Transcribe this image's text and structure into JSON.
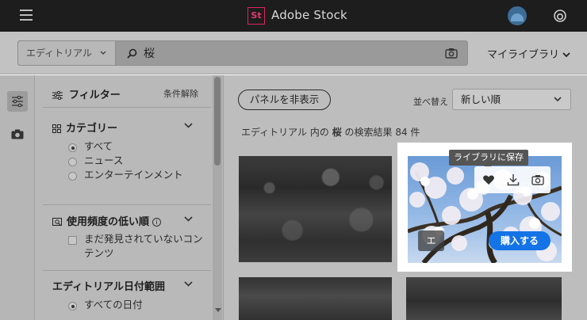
{
  "header": {
    "logo_text": "St",
    "brand": "Adobe Stock",
    "icons": [
      "hamburger-icon",
      "avatar",
      "creative-cloud-icon"
    ]
  },
  "search": {
    "type_selector": "エディトリアル",
    "query": "桜",
    "my_libraries": "マイライブラリ"
  },
  "filters": {
    "title": "フィルター",
    "clear_label": "条件解除",
    "categories": {
      "title": "カテゴリー",
      "options": [
        {
          "label": "すべて",
          "selected": true
        },
        {
          "label": "ニュース",
          "selected": false
        },
        {
          "label": "エンターテインメント",
          "selected": false
        }
      ]
    },
    "usage": {
      "title": "使用頻度の低い順",
      "info": "i",
      "option": "まだ発見されていないコンテンツ"
    },
    "date_range": {
      "title": "エディトリアル日付範囲",
      "option": "すべての日付"
    }
  },
  "results": {
    "hide_panel": "パネルを非表示",
    "sort_label": "並べ替え",
    "sort_value": "新しい順",
    "summary_prefix": "エディトリアル 内の",
    "summary_query": "桜",
    "summary_suffix": "の検索結果 84 件"
  },
  "card": {
    "tooltip": "ライブラリに保存",
    "tag": "エ",
    "buy_label": "購入する"
  },
  "colors": {
    "accent": "#1473e6",
    "logo": "#d9265d",
    "header_bg": "#1d1d1d"
  }
}
